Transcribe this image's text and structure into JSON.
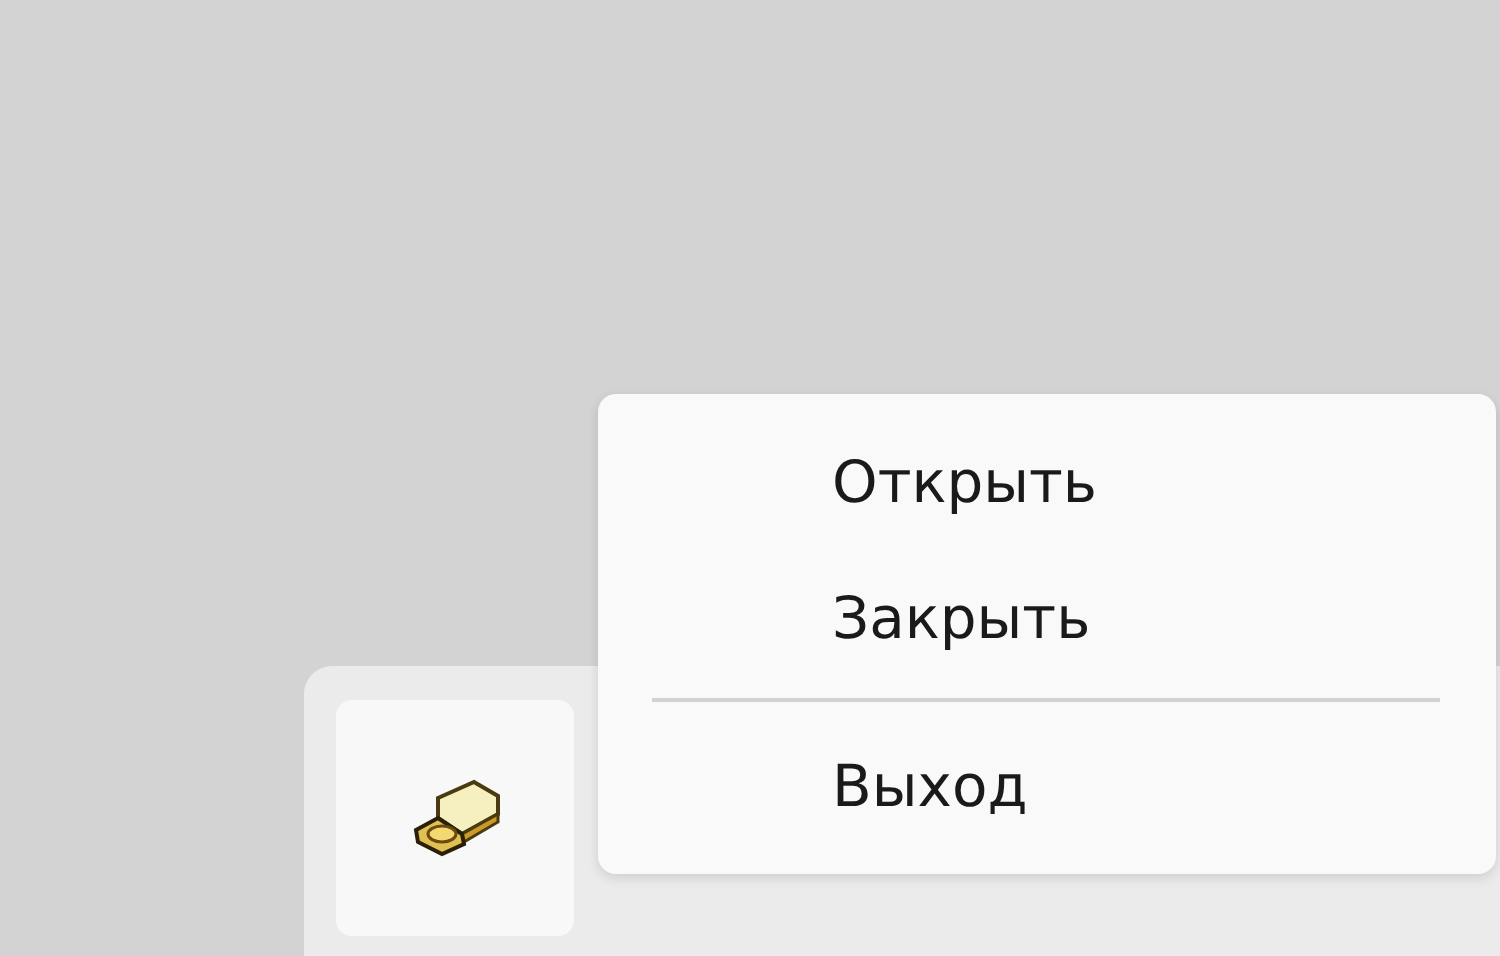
{
  "context_menu": {
    "items": [
      {
        "kind": "item",
        "label": "Открыть"
      },
      {
        "kind": "item",
        "label": "Закрыть"
      },
      {
        "kind": "separator"
      },
      {
        "kind": "item",
        "label": "Выход"
      }
    ]
  }
}
